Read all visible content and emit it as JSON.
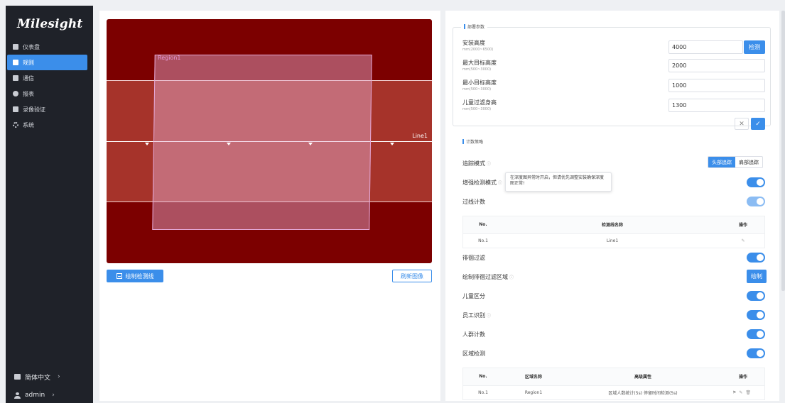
{
  "app": {
    "logo": "Milesight"
  },
  "sidebar": {
    "items": [
      {
        "label": "仪表盘",
        "icon": "dashboard-icon"
      },
      {
        "label": "规则",
        "icon": "rules-icon",
        "active": true
      },
      {
        "label": "通信",
        "icon": "communication-icon"
      },
      {
        "label": "报表",
        "icon": "report-icon"
      },
      {
        "label": "录像验证",
        "icon": "video-verify-icon"
      },
      {
        "label": "系统",
        "icon": "gear-icon"
      }
    ],
    "language": "简体中文",
    "user": "admin",
    "chevron": "›"
  },
  "image_panel": {
    "region_label": "Region1",
    "line_label": "Line1",
    "draw_button": "绘制检测线",
    "refresh_button": "刷新图像",
    "colors": {
      "background": "#7c0000",
      "region": "#e5a8d8",
      "accent": "#3b8eea"
    }
  },
  "deploy": {
    "title": "部署参数",
    "fields": [
      {
        "label": "安装高度",
        "range": "mm(2000~6500)",
        "value": "4000"
      },
      {
        "label": "最大目标高度",
        "range": "mm(500~3000)",
        "value": "2000"
      },
      {
        "label": "最小目标高度",
        "range": "mm(500~3000)",
        "value": "1000"
      },
      {
        "label": "儿童过滤身高",
        "range": "mm(500~3000)",
        "value": "1300"
      }
    ],
    "detect_button": "检测",
    "cancel_symbol": "✕",
    "confirm_symbol": "✓"
  },
  "counting": {
    "title": "计数策略",
    "tracking_mode_label": "追踪模式",
    "tracking_options": [
      "头部追踪",
      "肩部追踪"
    ],
    "enhanced_label": "增强检测模式",
    "tooltip": "在深度图异常时开启，但请优先调整安装确保深度图正常!",
    "line_count_label": "过线计数",
    "line_table": {
      "headers": [
        "No.",
        "检测线名称",
        "操作"
      ],
      "rows": [
        {
          "no": "No.1",
          "name": "Line1"
        }
      ]
    },
    "wander_filter_label": "徘徊过滤",
    "draw_wander_label": "绘制徘徊过滤区域",
    "draw_button": "绘制",
    "child_label": "儿童区分",
    "staff_label": "员工识别",
    "crowd_label": "人群计数",
    "region_label": "区域检测",
    "region_table": {
      "headers": [
        "No.",
        "区域名称",
        "高级属性",
        "操作"
      ],
      "rows": [
        {
          "no": "No.1",
          "name": "Region1",
          "attr": "区域人数统计(5s) 停留时间检测(5s)"
        }
      ]
    },
    "info_symbol": "ⓘ"
  }
}
